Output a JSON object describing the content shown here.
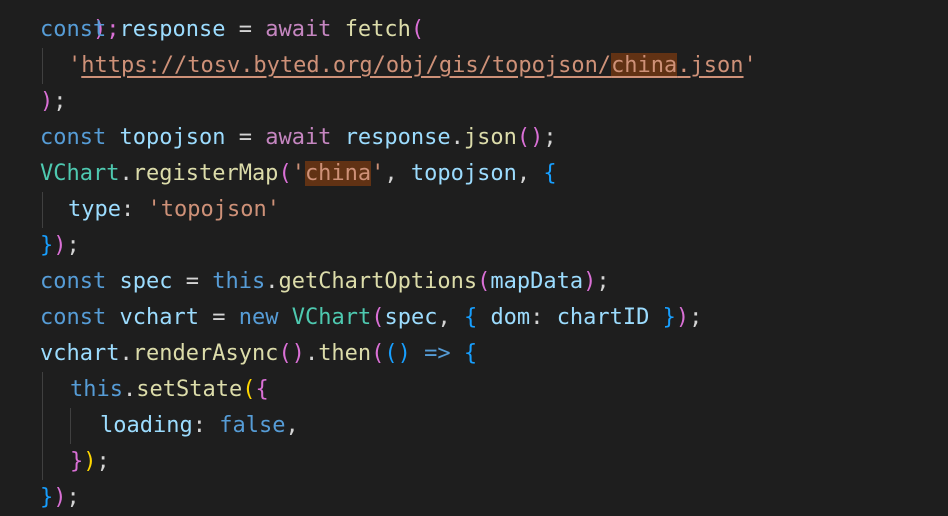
{
  "editor": {
    "colors": {
      "background": "#1e1e1e",
      "keyword": "#569cd6",
      "control": "#c586c0",
      "variable": "#9cdcfe",
      "function": "#dcdcaa",
      "class": "#4ec9b0",
      "string": "#ce9178",
      "find_highlight": "#613214"
    },
    "lines": {
      "l0": {
        "t0": ");"
      },
      "l1": {
        "t0": "const",
        "t1": " ",
        "t2": "response",
        "t3": " = ",
        "t4": "await",
        "t5": " ",
        "t6": "fetch",
        "t7": "("
      },
      "l2": {
        "t0": "'",
        "t1": "https://tosv.byted.org/obj/gis/topojson/",
        "t2": "china",
        "t3": ".json",
        "t4": "'"
      },
      "l3": {
        "t0": ")",
        "t1": ";"
      },
      "l4": {
        "t0": "const",
        "t1": " ",
        "t2": "topojson",
        "t3": " = ",
        "t4": "await",
        "t5": " ",
        "t6": "response",
        "t7": ".",
        "t8": "json",
        "t9": "()",
        "t10": ";"
      },
      "l5": {
        "t0": "VChart",
        "t1": ".",
        "t2": "registerMap",
        "t3": "(",
        "t4": "'",
        "t5": "china",
        "t6": "'",
        "t7": ", ",
        "t8": "topojson",
        "t9": ", ",
        "t10": "{"
      },
      "l6": {
        "t0": "type",
        "t1": ": ",
        "t2": "'topojson'"
      },
      "l7": {
        "t0": "}",
        "t1": ")",
        "t2": ";"
      },
      "l8": {
        "t0": "const",
        "t1": " ",
        "t2": "spec",
        "t3": " = ",
        "t4": "this",
        "t5": ".",
        "t6": "getChartOptions",
        "t7": "(",
        "t8": "mapData",
        "t9": ")",
        "t10": ";"
      },
      "l9": {
        "t0": "const",
        "t1": " ",
        "t2": "vchart",
        "t3": " = ",
        "t4": "new",
        "t5": " ",
        "t6": "VChart",
        "t7": "(",
        "t8": "spec",
        "t9": ", ",
        "t10": "{",
        "t11": " ",
        "t12": "dom",
        "t13": ": ",
        "t14": "chartID",
        "t15": " ",
        "t16": "}",
        "t17": ")",
        "t18": ";"
      },
      "l10": {
        "t0": "vchart",
        "t1": ".",
        "t2": "renderAsync",
        "t3": "()",
        "t4": ".",
        "t5": "then",
        "t6": "(",
        "t7": "()",
        "t8": " => ",
        "t9": "{"
      },
      "l11": {
        "t0": "this",
        "t1": ".",
        "t2": "setState",
        "t3": "(",
        "t4": "{"
      },
      "l12": {
        "t0": "loading",
        "t1": ": ",
        "t2": "false",
        "t3": ","
      },
      "l13": {
        "t0": "}",
        "t1": ")",
        "t2": ";"
      },
      "l14": {
        "t0": "}",
        "t1": ")",
        "t2": ";"
      }
    }
  }
}
